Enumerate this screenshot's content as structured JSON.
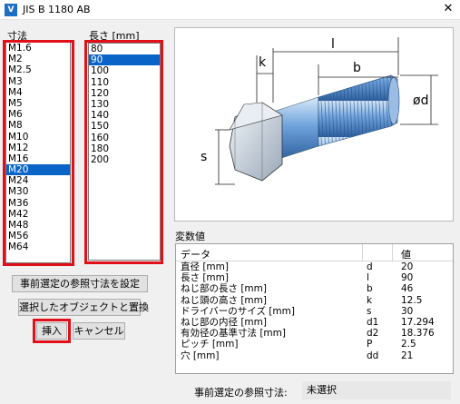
{
  "window": {
    "title": "JIS B 1180 AB",
    "app_icon": "V"
  },
  "size_list": {
    "label": "寸法",
    "items": [
      "M1.6",
      "M2",
      "M2.5",
      "M3",
      "M4",
      "M5",
      "M6",
      "M8",
      "M10",
      "M12",
      "M16",
      "M20",
      "M24",
      "M30",
      "M36",
      "M42",
      "M48",
      "M56",
      "M64"
    ],
    "selected": "M20"
  },
  "length_list": {
    "label": "長さ [mm]",
    "items": [
      "80",
      "90",
      "100",
      "110",
      "120",
      "130",
      "140",
      "150",
      "160",
      "180",
      "200"
    ],
    "selected": "90"
  },
  "buttons": {
    "set_preselect": "事前選定の参照寸法を設定",
    "replace_selected": "選択したオブジェクトと置換",
    "insert": "挿入",
    "cancel": "キャンセル"
  },
  "diagram": {
    "dim_k": "k",
    "dim_l": "l",
    "dim_b": "b",
    "dim_d": "ød",
    "dim_s": "s"
  },
  "variables": {
    "label": "変数値",
    "headers": {
      "data": "データ",
      "value": "値"
    },
    "rows": [
      {
        "name": "直径 [mm]",
        "sym": "d",
        "val": "20"
      },
      {
        "name": "長さ [mm]",
        "sym": "l",
        "val": "90"
      },
      {
        "name": "ねじ部の長さ [mm]",
        "sym": "b",
        "val": "46"
      },
      {
        "name": "ねじ頭の高さ [mm]",
        "sym": "k",
        "val": "12.5"
      },
      {
        "name": "ドライバーのサイズ [mm]",
        "sym": "s",
        "val": "30"
      },
      {
        "name": "ねじ部の内径 [mm]",
        "sym": "d1",
        "val": "17.294"
      },
      {
        "name": "有効径の基準寸法 [mm]",
        "sym": "d2",
        "val": "18.376"
      },
      {
        "name": "ピッチ [mm]",
        "sym": "P",
        "val": "2.5"
      },
      {
        "name": "穴 [mm]",
        "sym": "dd",
        "val": "21"
      }
    ]
  },
  "preselect": {
    "label": "事前選定の参照寸法:",
    "value": "未選択"
  },
  "colors": {
    "highlight_frame": "#e0101b",
    "selection": "#0a64c8"
  }
}
